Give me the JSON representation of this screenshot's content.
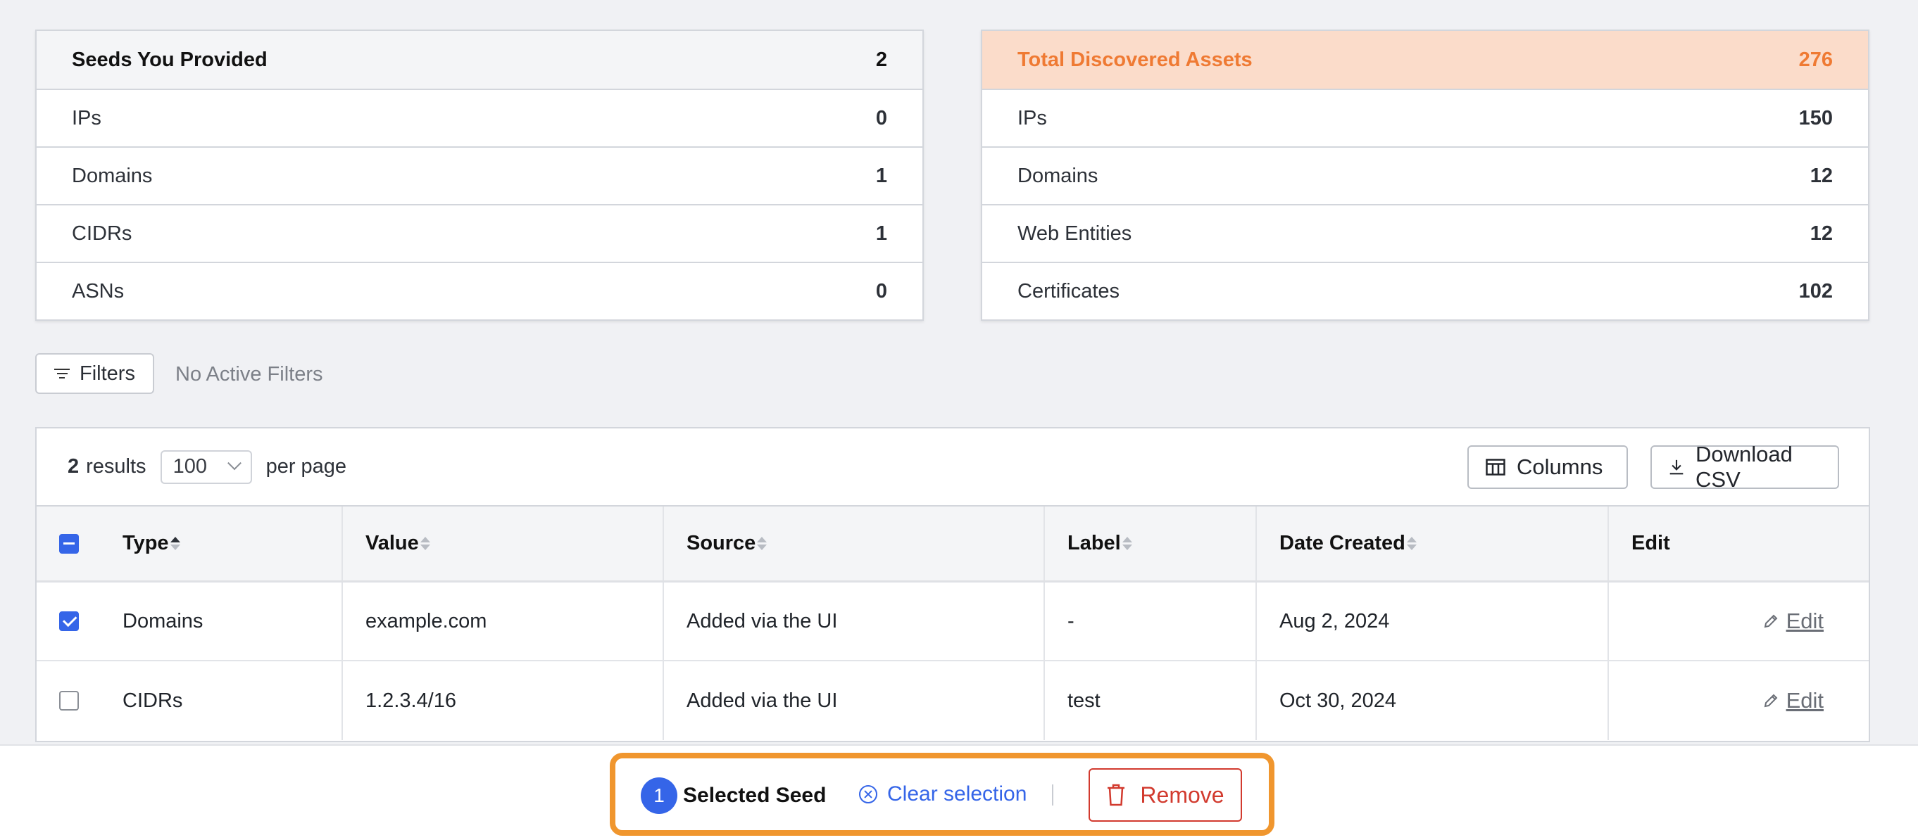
{
  "seeds_card": {
    "title": "Seeds You Provided",
    "total": "2",
    "rows": [
      {
        "label": "IPs",
        "value": "0"
      },
      {
        "label": "Domains",
        "value": "1"
      },
      {
        "label": "CIDRs",
        "value": "1"
      },
      {
        "label": "ASNs",
        "value": "0"
      }
    ]
  },
  "discovered_card": {
    "title": "Total Discovered Assets",
    "total": "276",
    "accent": "#ef7a33",
    "rows": [
      {
        "label": "IPs",
        "value": "150"
      },
      {
        "label": "Domains",
        "value": "12"
      },
      {
        "label": "Web Entities",
        "value": "12"
      },
      {
        "label": "Certificates",
        "value": "102"
      }
    ]
  },
  "filters": {
    "button_label": "Filters",
    "status": "No Active Filters"
  },
  "results": {
    "count": "2",
    "count_suffix": "results",
    "per_page_value": "100",
    "per_page_label": "per page",
    "columns_label": "Columns",
    "download_label": "Download CSV"
  },
  "table": {
    "headers": [
      "Type",
      "Value",
      "Source",
      "Label",
      "Date Created",
      "Edit"
    ],
    "rows": [
      {
        "type": "Domains",
        "value": "example.com",
        "source": "Added via the UI",
        "label": "-",
        "date": "Aug 2, 2024",
        "edit": "Edit",
        "checked": true
      },
      {
        "type": "CIDRs",
        "value": "1.2.3.4/16",
        "source": "Added via the UI",
        "label": "test",
        "date": "Oct 30, 2024",
        "edit": "Edit",
        "checked": false
      }
    ]
  },
  "selection_bar": {
    "count": "1",
    "label": "Selected Seed",
    "clear_label": "Clear selection",
    "remove_label": "Remove",
    "highlight_color": "#f0962e"
  }
}
